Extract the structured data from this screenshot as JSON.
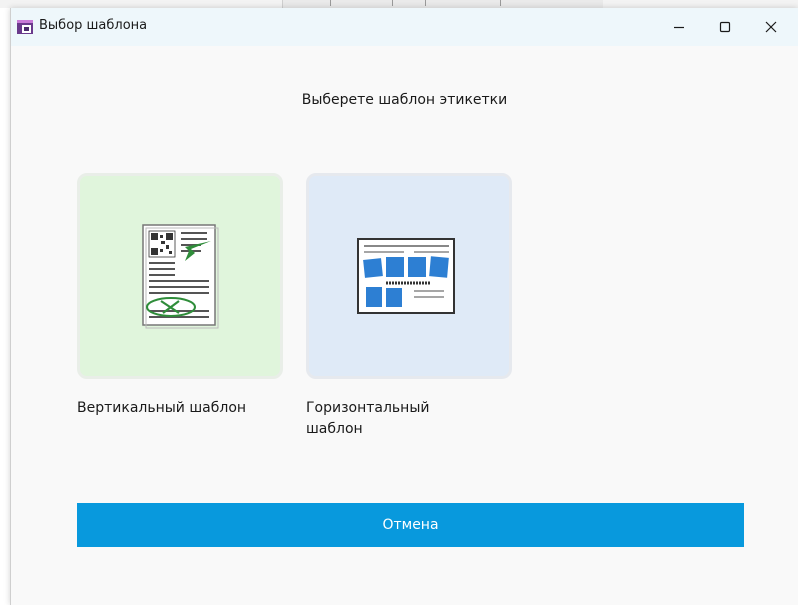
{
  "window": {
    "title": "Выбор шаблона",
    "icon": "app-window-icon",
    "controls": [
      "minimize-icon",
      "maximize-icon",
      "close-icon"
    ]
  },
  "heading": "Выберете шаблон этикетки",
  "templates": [
    {
      "label": "Вертикальный шаблон",
      "icon": "vertical-template-icon",
      "color": "#e0f5dc"
    },
    {
      "label": "Горизонтальный шаблон",
      "icon": "horizontal-template-icon",
      "color": "#dfeaf7"
    }
  ],
  "cancel_label": "Отмена",
  "colors": {
    "accent": "#0899dd",
    "titlebar": "#eef7fb"
  }
}
